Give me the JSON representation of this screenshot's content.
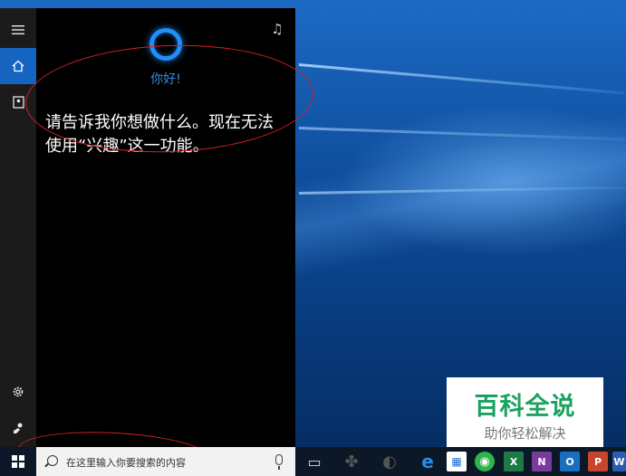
{
  "cortana": {
    "greeting": "你好!",
    "message": "请告诉我你想做什么。现在无法使用“兴趣”这一功能。"
  },
  "sidebar": {
    "items": [
      {
        "icon": "hamburger-menu-icon"
      },
      {
        "icon": "home-icon",
        "active": true
      },
      {
        "icon": "notebook-icon"
      },
      {
        "icon": "settings-gear-icon"
      },
      {
        "icon": "feedback-icon"
      }
    ]
  },
  "taskbar": {
    "search_placeholder": "在这里输入你要搜索的内容",
    "icons": [
      {
        "name": "task-view-icon",
        "glyph": "▭"
      },
      {
        "name": "pinwheel-app-icon",
        "glyph": "✤"
      },
      {
        "name": "circle-app-icon",
        "glyph": "◐"
      },
      {
        "name": "edge-icon",
        "glyph": "e"
      },
      {
        "name": "store-icon",
        "glyph": "▦"
      },
      {
        "name": "chrome-like-icon",
        "glyph": "◉"
      },
      {
        "name": "excel-icon",
        "glyph": "X"
      },
      {
        "name": "onenote-icon",
        "glyph": "N"
      },
      {
        "name": "outlook-icon",
        "glyph": "O"
      },
      {
        "name": "powerpoint-icon",
        "glyph": "P"
      },
      {
        "name": "word-icon",
        "glyph": "W"
      }
    ]
  },
  "watermark": {
    "title": "百科全说",
    "subtitle": "助你轻松解决"
  },
  "colors": {
    "accent": "#1565c0",
    "cortana_blue": "#1f8fff",
    "annotation_red": "#d0202a",
    "watermark_green": "#1aa260"
  }
}
